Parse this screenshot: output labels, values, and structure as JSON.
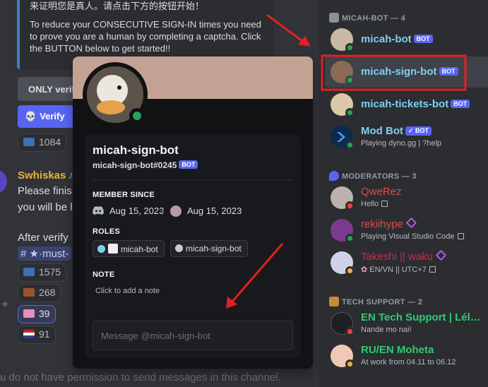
{
  "chat": {
    "embed_line1": "来证明您是真人。请点击下方的按钮开始！",
    "embed_line2": "To reduce your CONSECUTIVE SIGN-IN times you need to prove you are a human by completing a captcha. Click the BUTTON below to get started!!",
    "only_button_label": "ONLY verif",
    "verify_button_label": "Verify",
    "reactions": [
      {
        "count": "1084"
      },
      {
        "count": "1575"
      },
      {
        "count": "268"
      },
      {
        "count": "39"
      },
      {
        "count": "91"
      }
    ],
    "author": "Swhiskas",
    "message_line1": "Please finis",
    "message_line2": "you will be l",
    "message_line3": "After verify",
    "channel_mention": "# ★·must-",
    "permission_notice": "u do not have permission to send messages in this channel."
  },
  "popout": {
    "display_name": "micah-sign-bot",
    "username": "micah-sign-bot#0245",
    "bot_label": "BOT",
    "member_since_heading": "MEMBER SINCE",
    "discord_date": "Aug 15, 2023",
    "server_date": "Aug 15, 2023",
    "roles_heading": "ROLES",
    "roles": [
      {
        "name": "micah-bot",
        "color": "#7ecff3"
      },
      {
        "name": "micah-sign-bot",
        "color": "#c9cbcf"
      }
    ],
    "note_heading": "NOTE",
    "note_placeholder": "Click to add a note",
    "message_placeholder": "Message @micah-sign-bot",
    "banner_color": "#c4a293"
  },
  "members": {
    "categories": [
      {
        "label": "MICAH-BOT — 4"
      },
      {
        "label": "MODERATORS — 3"
      },
      {
        "label": "TECH SUPPORT — 2"
      }
    ],
    "list": [
      {
        "name": "micah-bot",
        "tag": "BOT",
        "subtitle": "",
        "color": "#7ecff3",
        "status": "online"
      },
      {
        "name": "micah-sign-bot",
        "tag": "BOT",
        "subtitle": "",
        "color": "#7ecff3",
        "status": "online"
      },
      {
        "name": "micah-tickets-bot",
        "tag": "BOT",
        "subtitle": "",
        "color": "#7ecff3",
        "status": "online"
      },
      {
        "name": "Mod Bot",
        "tag": "✓ BOT",
        "subtitle": "Playing dyno.gg | ?help",
        "color": "#7ecff3",
        "status": "online"
      },
      {
        "name": "QweRez",
        "tag": "",
        "subtitle": "Hello",
        "color": "#e04b4b",
        "status": "dnd"
      },
      {
        "name": "rekiihype",
        "tag": "",
        "subtitle": "Playing Visual Studio Code",
        "color": "#e04b4b",
        "status": "online"
      },
      {
        "name": "Takeshi || waku",
        "tag": "",
        "subtitle": "EN/VN || UTC+7",
        "color": "#c12f4f",
        "status": "idle"
      },
      {
        "name": "EN Tech Support | Lél…",
        "tag": "",
        "subtitle": "Nande mo nai!",
        "color": "#2ecc71",
        "status": "dnd"
      },
      {
        "name": "RU/EN Moheta",
        "tag": "",
        "subtitle": "At work from 04.11 to 06.12",
        "color": "#2ecc71",
        "status": "idle"
      }
    ]
  },
  "colors": {
    "online": "#23a55a",
    "dnd": "#f23f43",
    "idle": "#f0b232",
    "blurple": "#5865f2",
    "annotation_red": "#e32020"
  }
}
